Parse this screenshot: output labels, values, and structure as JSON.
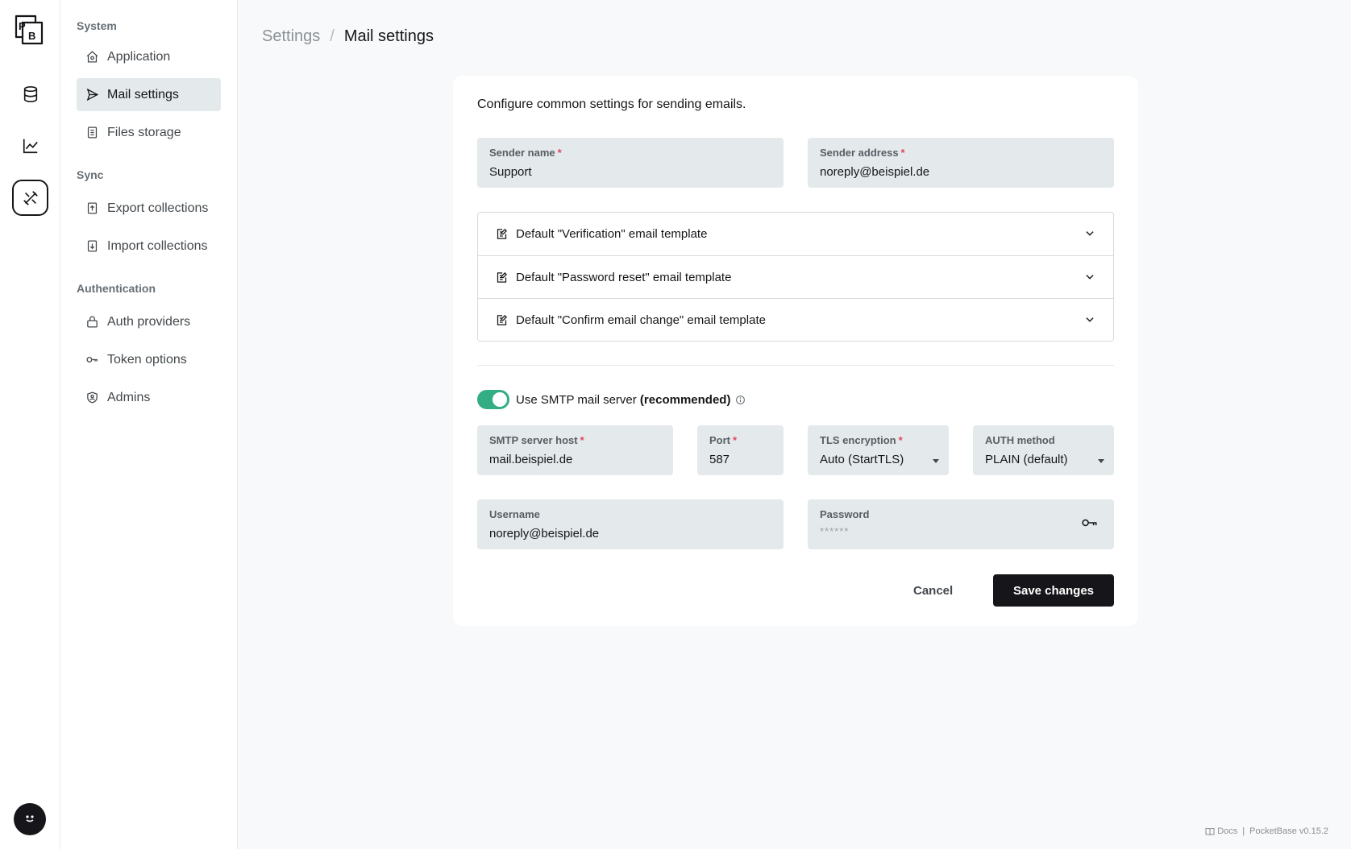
{
  "brand": {
    "logo": "PB"
  },
  "rail": {
    "items": [
      "collections-icon",
      "logs-icon",
      "settings-icon"
    ],
    "active": "settings-icon"
  },
  "sidebar": {
    "groups": [
      {
        "title": "System",
        "items": [
          {
            "label": "Application",
            "icon": "home-icon"
          },
          {
            "label": "Mail settings",
            "icon": "send-icon",
            "active": true
          },
          {
            "label": "Files storage",
            "icon": "file-icon"
          }
        ]
      },
      {
        "title": "Sync",
        "items": [
          {
            "label": "Export collections",
            "icon": "export-icon"
          },
          {
            "label": "Import collections",
            "icon": "import-icon"
          }
        ]
      },
      {
        "title": "Authentication",
        "items": [
          {
            "label": "Auth providers",
            "icon": "lock-icon"
          },
          {
            "label": "Token options",
            "icon": "key-icon"
          },
          {
            "label": "Admins",
            "icon": "shield-icon"
          }
        ]
      }
    ]
  },
  "breadcrumb": {
    "parent": "Settings",
    "separator": "/",
    "current": "Mail settings"
  },
  "form": {
    "intro": "Configure common settings for sending emails.",
    "sender_name": {
      "label": "Sender name",
      "value": "Support"
    },
    "sender_address": {
      "label": "Sender address",
      "value": "noreply@beispiel.de"
    },
    "templates": [
      "Default \"Verification\" email template",
      "Default \"Password reset\" email template",
      "Default \"Confirm email change\" email template"
    ],
    "smtp_toggle": {
      "label": "Use SMTP mail server ",
      "emphasis": "(recommended)",
      "enabled": true
    },
    "smtp_host": {
      "label": "SMTP server host",
      "value": "mail.beispiel.de"
    },
    "port": {
      "label": "Port",
      "value": "587"
    },
    "tls": {
      "label": "TLS encryption",
      "value": "Auto (StartTLS)"
    },
    "auth_method": {
      "label": "AUTH method",
      "value": "PLAIN (default)"
    },
    "username": {
      "label": "Username",
      "value": "noreply@beispiel.de"
    },
    "password": {
      "label": "Password",
      "value": "******"
    },
    "required_mark": "*",
    "cancel_label": "Cancel",
    "save_label": "Save changes"
  },
  "footer": {
    "docs": "Docs",
    "separator": "|",
    "version": "PocketBase v0.15.2"
  },
  "colors": {
    "accent": "#16161a",
    "toggle_on": "#32ad84",
    "required": "#e34562",
    "field_bg": "#e4e9ec"
  }
}
